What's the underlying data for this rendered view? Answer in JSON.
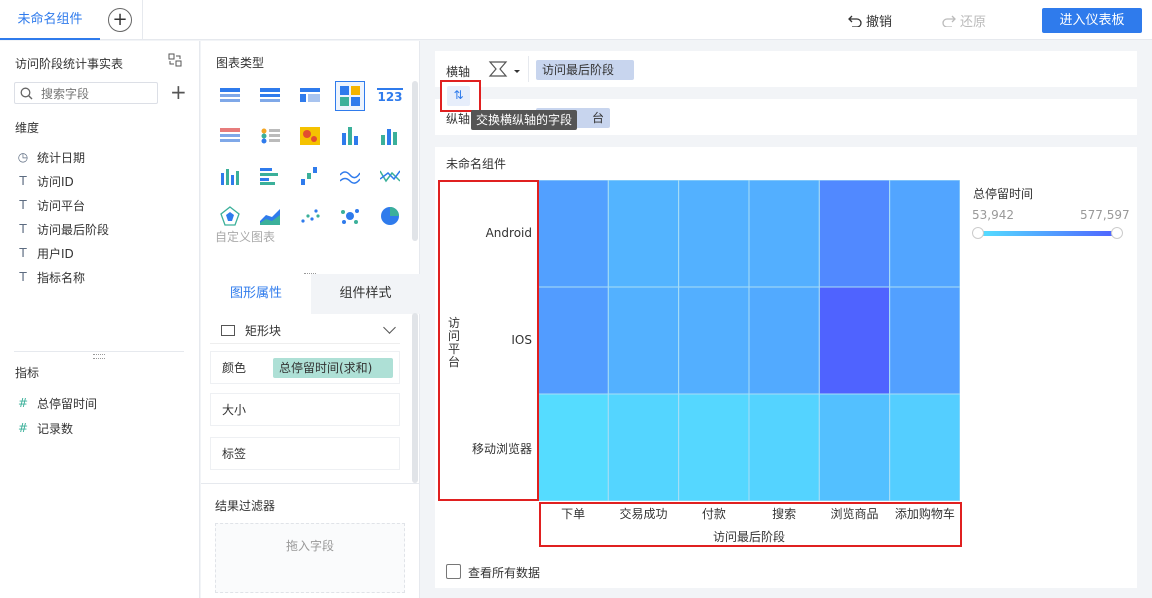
{
  "topbar": {
    "tab_label": "未命名组件",
    "undo_label": "撤销",
    "redo_label": "还原",
    "enter_label": "进入仪表板"
  },
  "left": {
    "table_title": "访问阶段统计事实表",
    "search_placeholder": "搜索字段",
    "dimension_title": "维度",
    "dimensions": [
      {
        "icon": "clock-icon",
        "label": "统计日期"
      },
      {
        "icon": "text-icon",
        "label": "访问ID"
      },
      {
        "icon": "text-icon",
        "label": "访问平台"
      },
      {
        "icon": "text-icon",
        "label": "访问最后阶段"
      },
      {
        "icon": "text-icon",
        "label": "用户ID"
      },
      {
        "icon": "text-icon",
        "label": "指标名称"
      }
    ],
    "measure_title": "指标",
    "measures": [
      {
        "icon": "number-icon",
        "label": "总停留时间"
      },
      {
        "icon": "number-icon",
        "label": "记录数"
      }
    ]
  },
  "middle": {
    "chart_type_title": "图表类型",
    "custom_chart_label": "自定义图表",
    "tab_shape": "图形属性",
    "tab_style": "组件样式",
    "shape_value": "矩形块",
    "color_label": "颜色",
    "color_field": "总停留时间(求和)",
    "size_label": "大小",
    "tag_label": "标签",
    "filter_title": "结果过滤器",
    "filter_drop": "拖入字段"
  },
  "axes": {
    "x_label": "横轴",
    "x_field": "访问最后阶段",
    "y_label": "纵轴",
    "y_field_visible": "台",
    "swap_tooltip": "交换横纵轴的字段"
  },
  "colors": {
    "accent": "#2f7bec",
    "red_highlight": "#e02020"
  },
  "chart_data": {
    "type": "heatmap",
    "title": "未命名组件",
    "xlabel": "访问最后阶段",
    "ylabel": "访问平台",
    "x": [
      "下单",
      "交易成功",
      "付款",
      "搜索",
      "浏览商品",
      "添加购物车"
    ],
    "y": [
      "Android",
      "IOS",
      "移动浏览器"
    ],
    "values": [
      [
        320000,
        240000,
        250000,
        260000,
        420000,
        300000
      ],
      [
        340000,
        250000,
        260000,
        280000,
        577597,
        320000
      ],
      [
        70000,
        100000,
        90000,
        110000,
        190000,
        130000
      ]
    ],
    "legend_title": "总停留时间",
    "legend_min": "53,942",
    "legend_max": "577,597",
    "color_range": [
      "#55e0ff",
      "#4f63ff"
    ]
  },
  "footer": {
    "view_all_label": "查看所有数据"
  }
}
